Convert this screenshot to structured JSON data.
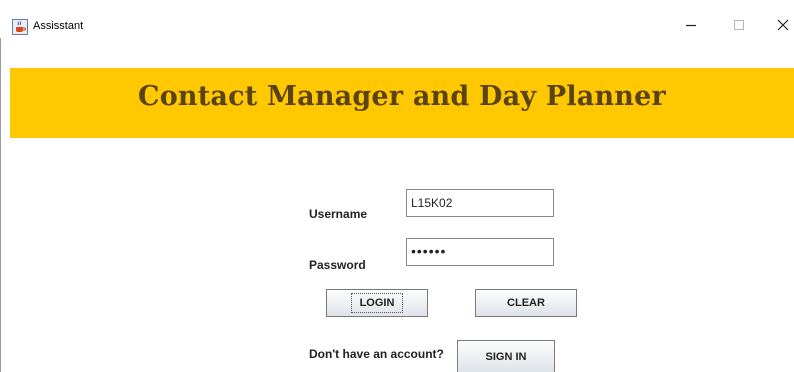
{
  "window": {
    "title": "Assisstant"
  },
  "icons": {
    "app": "java-cup-icon",
    "minimize": "minimize-icon",
    "maximize": "maximize-icon",
    "close": "close-icon"
  },
  "banner": {
    "title": "Contact Manager and Day Planner",
    "background": "#ffc800",
    "text_color": "#5a4414"
  },
  "form": {
    "username_label": "Username",
    "username_value": "L15K02",
    "password_label": "Password",
    "password_value": "••••••",
    "login_label": "LOGIN",
    "clear_label": "CLEAR",
    "account_prompt": "Don't have an account?",
    "signin_label": "SIGN IN"
  }
}
